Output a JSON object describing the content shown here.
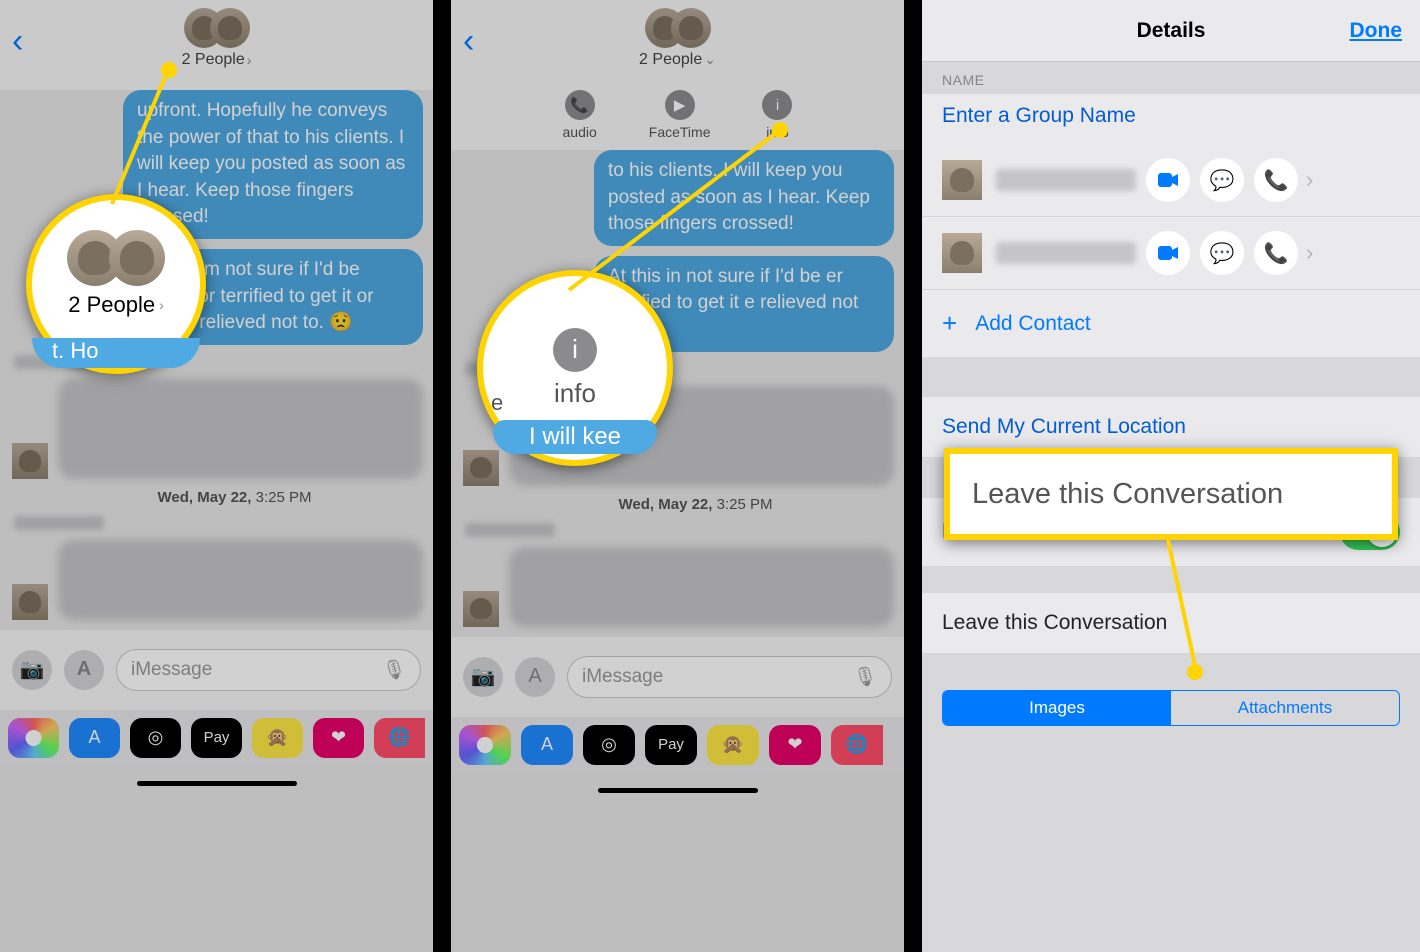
{
  "panel1": {
    "people_label": "2 People",
    "bubble1": "upfront.  Hopefully he conveys the power of that to his clients.  I will keep you posted as soon as I hear. Keep those fingers crossed!",
    "bubble2": "At this     I'm not sure if I'd be thrilled or terrified to get it or maybe relieved not to. 😟",
    "timestamp_bold": "Wed, May 22, ",
    "timestamp_light": "3:25 PM",
    "input_placeholder": "iMessage",
    "callout_people": "2 People",
    "callout_fragment": "t.   Ho"
  },
  "panel2": {
    "people_label": "2 People",
    "actions": {
      "audio": "audio",
      "facetime": "FaceTime",
      "info": "info"
    },
    "bubble1": "to his clients.  I will keep you posted as soon as I hear. Keep those fingers crossed!",
    "bubble2": "At this     in not sure if I'd be  er terrified to get it e relieved not to. 😟",
    "timestamp_bold": "Wed, May 22, ",
    "timestamp_light": "3:25 PM",
    "input_placeholder": "iMessage",
    "callout_info": "info",
    "callout_left_letter": "e",
    "callout_bottom": "I will kee"
  },
  "panel3": {
    "title": "Details",
    "done": "Done",
    "name_header": "NAME",
    "group_name_placeholder": "Enter a Group Name",
    "add_contact": "Add Contact",
    "send_location": "Send My Current Location",
    "hide_alerts": "Hide Alerts",
    "leave": "Leave this Conversation",
    "callout_leave": "Leave this Conversation",
    "segment": {
      "images": "Images",
      "attachments": "Attachments"
    }
  },
  "apprail": {
    "pay": "Pay"
  }
}
